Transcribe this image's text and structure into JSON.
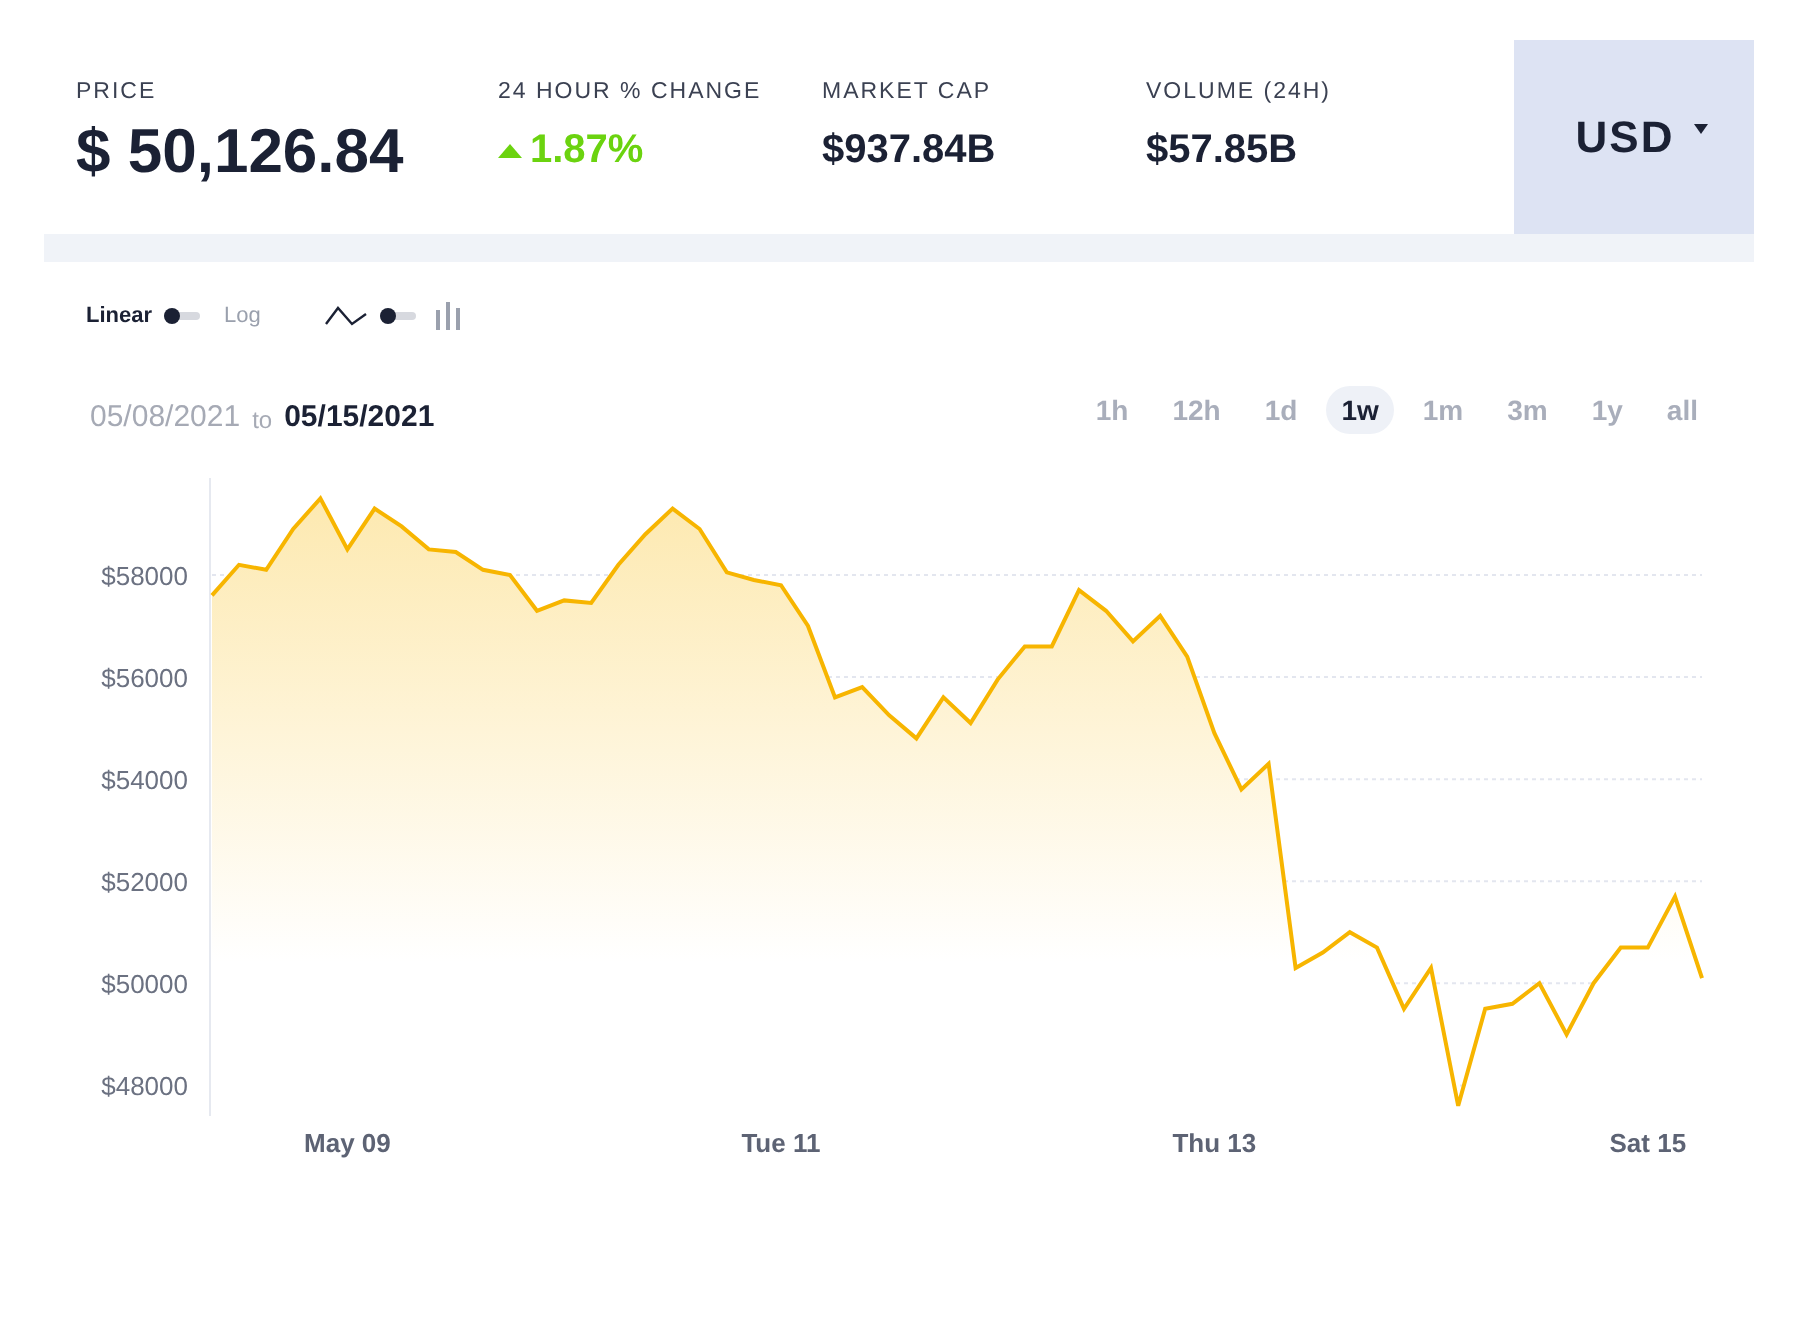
{
  "stats": [
    {
      "label": "PRICE",
      "value": "$ 50,126.84",
      "kind": "price"
    },
    {
      "label": "24 HOUR % CHANGE",
      "value": "1.87%",
      "kind": "change"
    },
    {
      "label": "MARKET CAP",
      "value": "$937.84B",
      "kind": "plain"
    },
    {
      "label": "VOLUME (24H)",
      "value": "$57.85B",
      "kind": "plain"
    }
  ],
  "currency": {
    "value": "USD"
  },
  "scale_toggle": {
    "left_label": "Linear",
    "right_label": "Log",
    "on": false
  },
  "type_toggle": {
    "on": false
  },
  "date_range": {
    "from": "05/08/2021",
    "connector": "to",
    "to": "05/15/2021"
  },
  "ranges": [
    {
      "label": "1h",
      "selected": false
    },
    {
      "label": "12h",
      "selected": false
    },
    {
      "label": "1d",
      "selected": false
    },
    {
      "label": "1w",
      "selected": true
    },
    {
      "label": "1m",
      "selected": false
    },
    {
      "label": "3m",
      "selected": false
    },
    {
      "label": "1y",
      "selected": false
    },
    {
      "label": "all",
      "selected": false
    }
  ],
  "chart_data": {
    "type": "area",
    "grid": true,
    "ylim": [
      47400,
      59900
    ],
    "categories": [
      null,
      null,
      null,
      null,
      null,
      "May 09",
      null,
      null,
      null,
      null,
      null,
      null,
      null,
      null,
      null,
      null,
      null,
      null,
      null,
      null,
      null,
      "Tue 11",
      null,
      null,
      null,
      null,
      null,
      null,
      null,
      null,
      null,
      null,
      null,
      null,
      null,
      null,
      null,
      "Thu 13",
      null,
      null,
      null,
      null,
      null,
      null,
      null,
      null,
      null,
      null,
      null,
      null,
      null,
      null,
      null,
      "Sat 15",
      null,
      null
    ],
    "yticks": [
      {
        "value": 48000,
        "label": "$48000"
      },
      {
        "value": 50000,
        "label": "$50000"
      },
      {
        "value": 52000,
        "label": "$52000"
      },
      {
        "value": 54000,
        "label": "$54000"
      },
      {
        "value": 56000,
        "label": "$56000"
      },
      {
        "value": 58000,
        "label": "$58000"
      }
    ],
    "series": [
      {
        "color": "#f7b500",
        "values": [
          57600,
          58200,
          58100,
          58900,
          59500,
          58500,
          59300,
          58950,
          58500,
          58450,
          58100,
          58000,
          57300,
          57500,
          57450,
          58200,
          58800,
          59300,
          58900,
          58050,
          57900,
          57800,
          57000,
          55600,
          55800,
          55250,
          54800,
          55600,
          55100,
          55950,
          56600,
          56600,
          57700,
          57300,
          56700,
          57200,
          56400,
          54900,
          53800,
          54300,
          50300,
          50600,
          51000,
          50700,
          49500,
          50300,
          47600,
          49500,
          49600,
          50000,
          49000,
          50000,
          50700,
          50700,
          51700,
          50100
        ]
      }
    ]
  }
}
